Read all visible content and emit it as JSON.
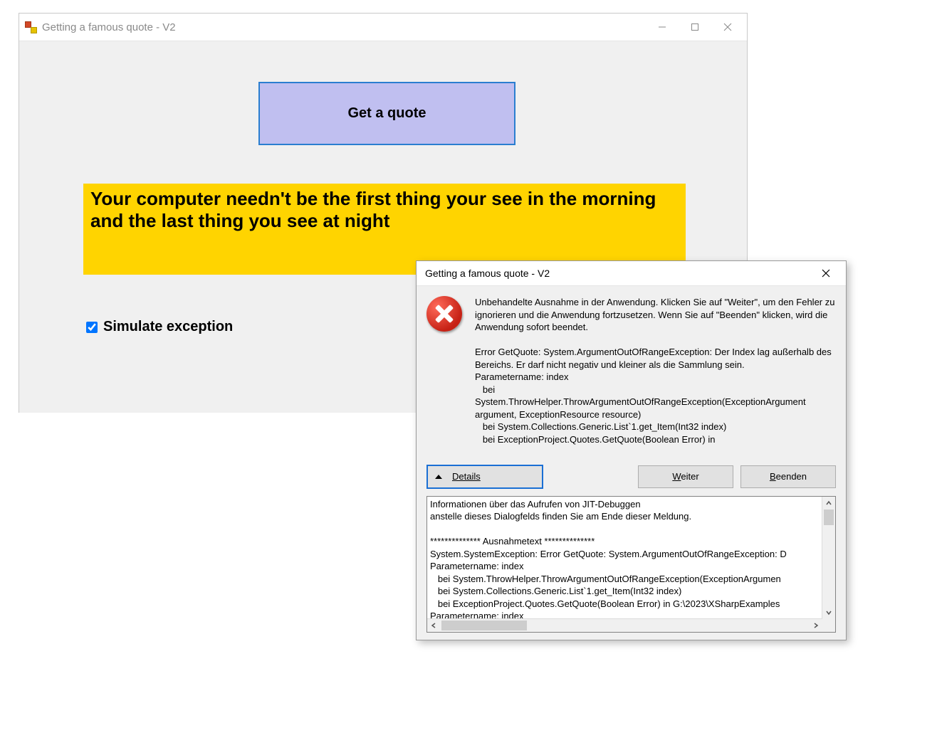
{
  "mainWindow": {
    "title": "Getting a famous quote - V2",
    "getQuoteLabel": "Get a quote",
    "quoteText": "Your computer needn't be the first thing your see in the morning and the last thing you see at night",
    "simulateExceptionLabel": "Simulate exception",
    "simulateExceptionChecked": true
  },
  "errorDialog": {
    "title": "Getting a famous quote - V2",
    "message": "Unbehandelte Ausnahme in der Anwendung. Klicken Sie auf \"Weiter\", um den Fehler zu ignorieren und die Anwendung fortzusetzen. Wenn Sie auf \"Beenden\" klicken, wird die Anwendung sofort beendet.\n\nError GetQuote: System.ArgumentOutOfRangeException: Der Index lag außerhalb des Bereichs. Er darf nicht negativ und kleiner als die Sammlung sein.\nParametername: index\n   bei\nSystem.ThrowHelper.ThrowArgumentOutOfRangeException(ExceptionArgument argument, ExceptionResource resource)\n   bei System.Collections.Generic.List`1.get_Item(Int32 index)\n   bei ExceptionProject.Quotes.GetQuote(Boolean Error) in",
    "detailsLabel": "Details",
    "continueLabel_pre": "W",
    "continueLabel_post": "eiter",
    "quitLabel_pre": "B",
    "quitLabel_post": "eenden",
    "detailsText": "Informationen über das Aufrufen von JIT-Debuggen\nanstelle dieses Dialogfelds finden Sie am Ende dieser Meldung.\n\n************** Ausnahmetext **************\nSystem.SystemException: Error GetQuote: System.ArgumentOutOfRangeException: D\nParametername: index\n   bei System.ThrowHelper.ThrowArgumentOutOfRangeException(ExceptionArgumen\n   bei System.Collections.Generic.List`1.get_Item(Int32 index)\n   bei ExceptionProject.Quotes.GetQuote(Boolean Error) in G:\\2023\\XSharpExamples\nParametername: index"
  }
}
